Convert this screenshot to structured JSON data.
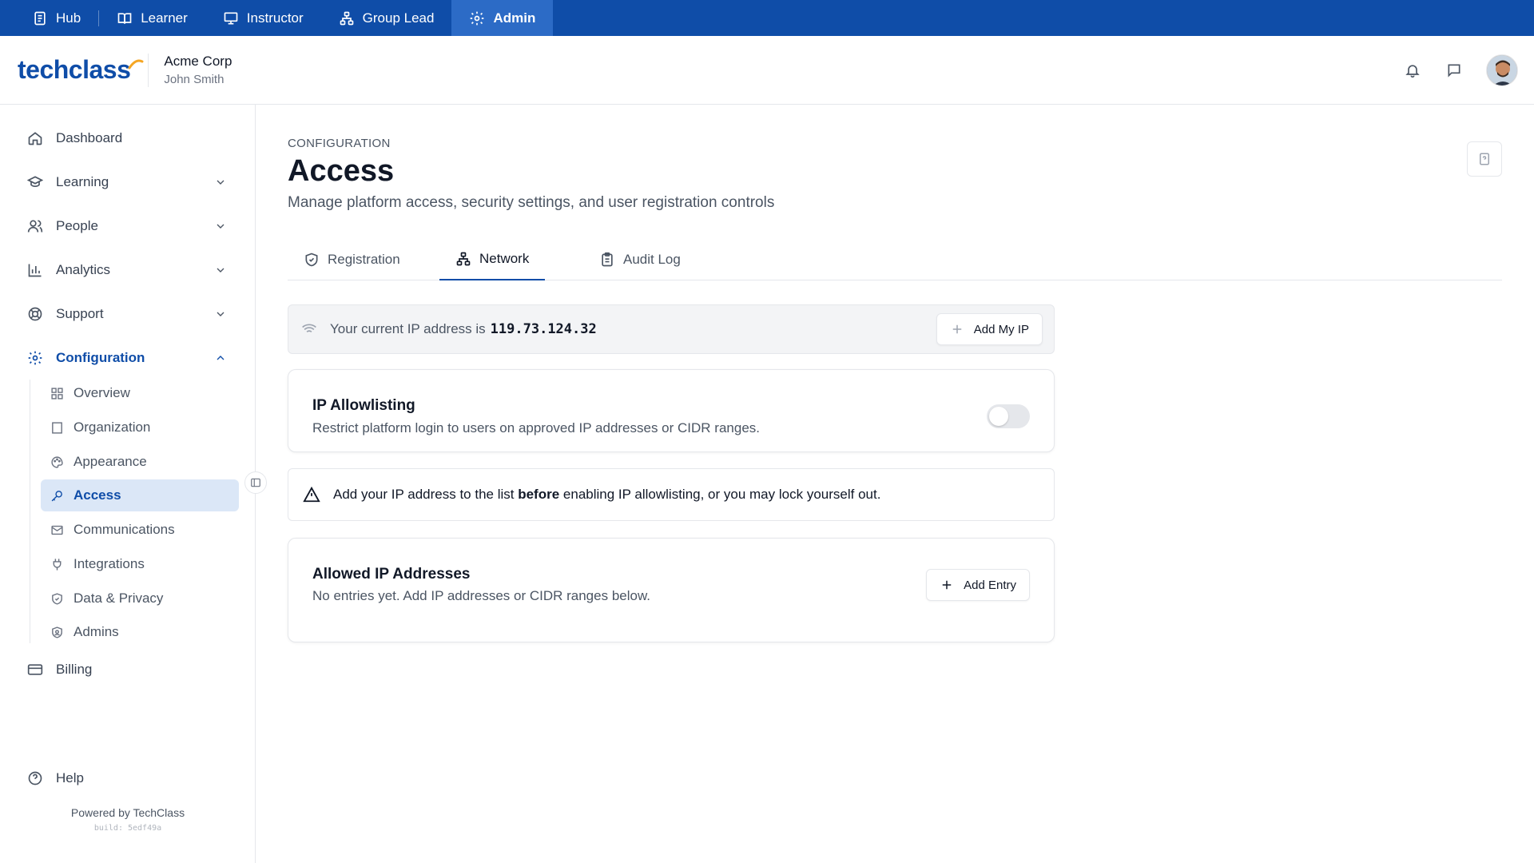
{
  "roles": [
    {
      "label": "Hub",
      "icon": "document-icon"
    },
    {
      "label": "Learner",
      "icon": "book-icon"
    },
    {
      "label": "Instructor",
      "icon": "presentation-icon"
    },
    {
      "label": "Group Lead",
      "icon": "group-icon"
    },
    {
      "label": "Admin",
      "icon": "gear-icon",
      "active": true
    }
  ],
  "header": {
    "logo": "techclass",
    "org_name": "Acme Corp",
    "user_name": "John Smith"
  },
  "sidebar": {
    "items": [
      {
        "label": "Dashboard"
      },
      {
        "label": "Learning"
      },
      {
        "label": "People"
      },
      {
        "label": "Analytics"
      },
      {
        "label": "Support"
      },
      {
        "label": "Configuration"
      }
    ],
    "sub_items": [
      {
        "label": "Overview"
      },
      {
        "label": "Organization"
      },
      {
        "label": "Appearance"
      },
      {
        "label": "Access"
      },
      {
        "label": "Communications"
      },
      {
        "label": "Integrations"
      },
      {
        "label": "Data & Privacy"
      },
      {
        "label": "Admins"
      }
    ],
    "billing": "Billing",
    "help": "Help",
    "powered_by": "Powered by TechClass",
    "build": "build: 5edf49a"
  },
  "page": {
    "eyebrow": "CONFIGURATION",
    "title": "Access",
    "subtitle": "Manage platform access, security settings, and user registration controls"
  },
  "tabs": [
    {
      "label": "Registration"
    },
    {
      "label": "Network",
      "active": true
    },
    {
      "label": "Audit Log"
    }
  ],
  "ip_bar": {
    "text": "Your current IP address is",
    "ip": "119.73.124.32",
    "button": "Add My IP"
  },
  "allowlisting": {
    "title": "IP Allowlisting",
    "description": "Restrict platform login to users on approved IP addresses or CIDR ranges.",
    "enabled": false
  },
  "warning": {
    "text_before": "Add your IP address to the list",
    "text_bold": "before",
    "text_after": "enabling IP allowlisting, or you may lock yourself out."
  },
  "allowed": {
    "title": "Allowed IP Addresses",
    "empty_text": "No entries yet. Add IP addresses or CIDR ranges below.",
    "button": "Add Entry"
  },
  "colors": {
    "brand": "#0f4da8",
    "active_bg": "#dbe7f7"
  }
}
